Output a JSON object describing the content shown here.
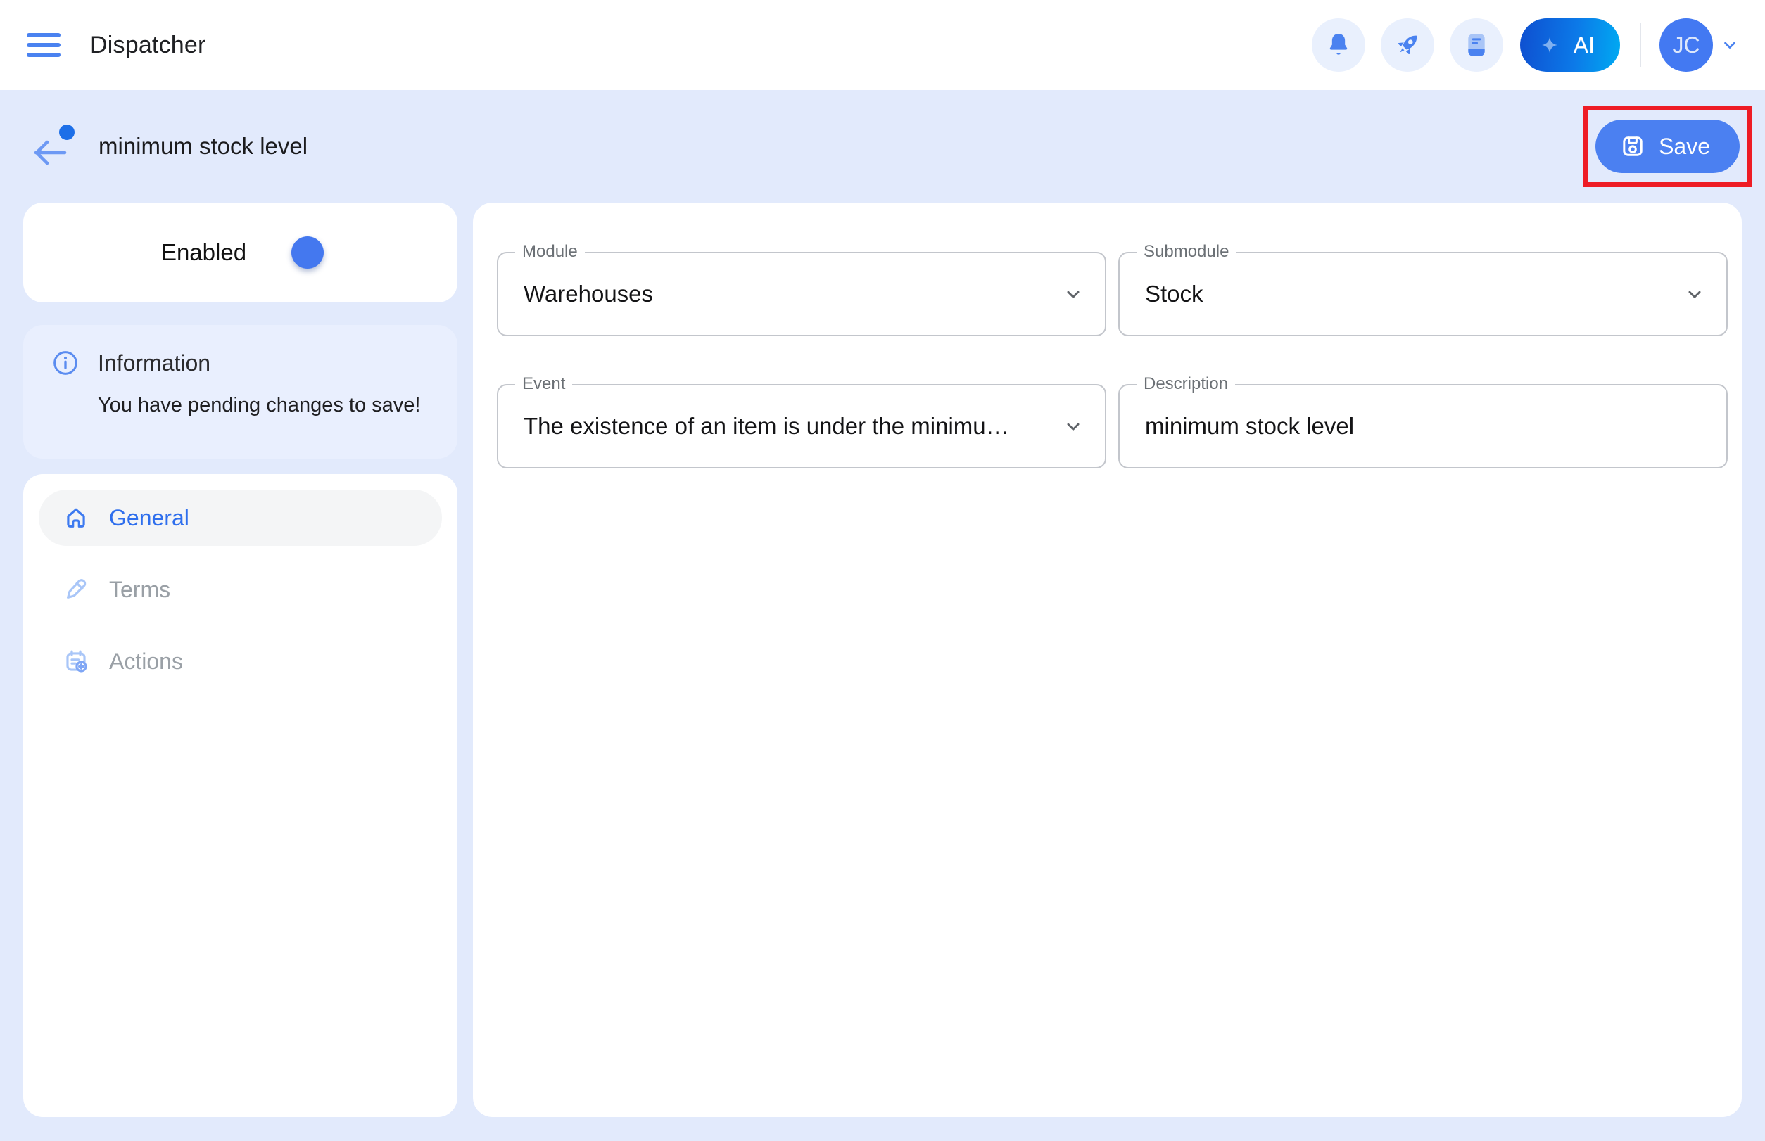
{
  "navbar": {
    "title": "Dispatcher",
    "ai_button_label": "AI",
    "avatar_initials": "JC",
    "icons": [
      "menu-icon",
      "bell-icon",
      "rocket-icon",
      "book-icon",
      "sparkle-icon",
      "chevron-down-icon"
    ]
  },
  "header": {
    "title": "minimum stock level",
    "save_label": "Save",
    "save_icon": "floppy-save-icon",
    "back_icon": "back-arrow-icon",
    "back_badge": "unsaved-dot"
  },
  "sidebar": {
    "enabled_label": "Enabled",
    "enabled_on": true,
    "info": {
      "icon": "info-icon",
      "title": "Information",
      "message": "You have pending changes to save!"
    },
    "nav_items": [
      {
        "label": "General",
        "icon": "home-icon",
        "active": true
      },
      {
        "label": "Terms",
        "icon": "pencil-icon",
        "active": false
      },
      {
        "label": "Actions",
        "icon": "calendar-add-icon",
        "active": false
      }
    ]
  },
  "form": {
    "module": {
      "label": "Module",
      "value": "Warehouses"
    },
    "submodule": {
      "label": "Submodule",
      "value": "Stock"
    },
    "event": {
      "label": "Event",
      "value": "The existence of an item is under the minimu…"
    },
    "description": {
      "label": "Description",
      "value": "minimum stock level"
    }
  },
  "colors": {
    "primary_blue": "#4a80f0",
    "page_background": "#e2eafc",
    "info_card_background": "#e9effe",
    "ai_gradient_start": "#0e4fd0",
    "ai_gradient_end": "#00aaf2",
    "highlight_red": "#ee1c25",
    "inactive_text": "#9aa0a6"
  }
}
